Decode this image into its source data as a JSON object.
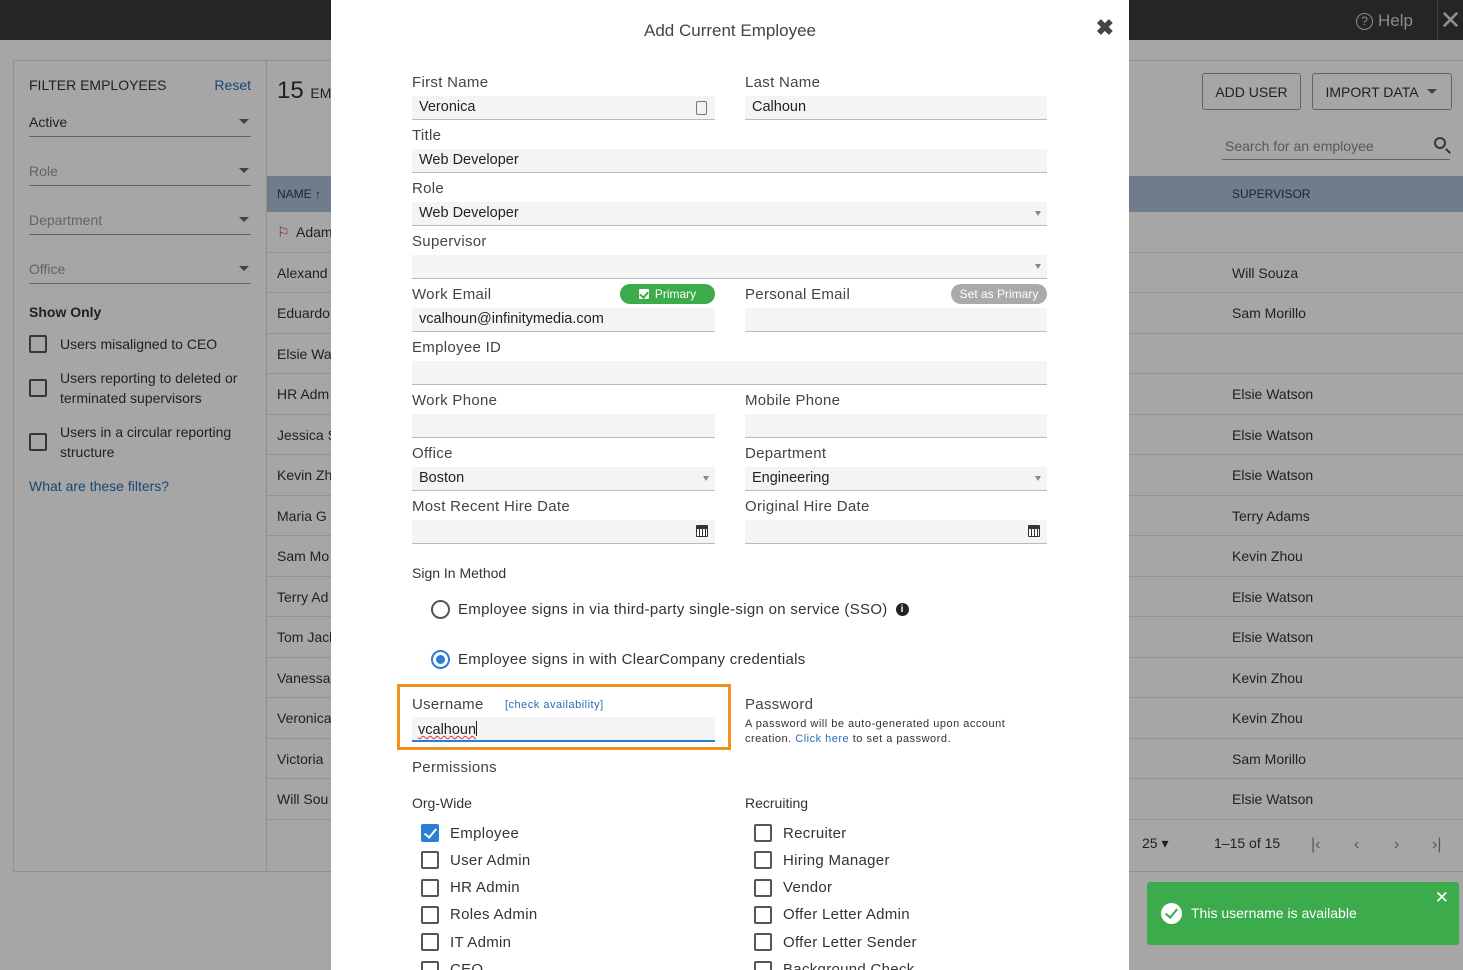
{
  "topbar": {
    "help_label": "Help",
    "help_icon": "question-circle-icon",
    "close_icon": "close-icon"
  },
  "sidebar": {
    "title": "FILTER EMPLOYEES",
    "reset_label": "Reset",
    "status_value": "Active",
    "role_placeholder": "Role",
    "department_placeholder": "Department",
    "office_placeholder": "Office",
    "show_only_title": "Show Only",
    "checks": [
      "Users misaligned to CEO",
      "Users reporting to deleted or terminated supervisors",
      "Users in a circular reporting structure"
    ],
    "help_link": "What are these filters?"
  },
  "main": {
    "count": "15",
    "count_suffix": "EM",
    "add_user_label": "ADD USER",
    "import_label": "IMPORT DATA",
    "search_placeholder": "Search for an employee",
    "col_name": "NAME",
    "col_supervisor": "SUPERVISOR",
    "rows": [
      {
        "name": "Adam",
        "supervisor": ""
      },
      {
        "name": "Alexand",
        "supervisor": "Will Souza"
      },
      {
        "name": "Eduardo",
        "supervisor": "Sam Morillo"
      },
      {
        "name": "Elsie Wa",
        "supervisor": ""
      },
      {
        "name": "HR Adm",
        "supervisor": "Elsie Watson"
      },
      {
        "name": "Jessica S",
        "supervisor": "Elsie Watson"
      },
      {
        "name": "Kevin Zh",
        "supervisor": "Elsie Watson"
      },
      {
        "name": "Maria G",
        "supervisor": "Terry Adams"
      },
      {
        "name": "Sam Mo",
        "supervisor": "Kevin Zhou"
      },
      {
        "name": "Terry Ad",
        "supervisor": "Elsie Watson"
      },
      {
        "name": "Tom Jack",
        "supervisor": "Elsie Watson"
      },
      {
        "name": "Vanessa",
        "supervisor": "Kevin Zhou"
      },
      {
        "name": "Veronica",
        "supervisor": "Kevin Zhou"
      },
      {
        "name": "Victoria",
        "supervisor": "Sam Morillo"
      },
      {
        "name": "Will Sou",
        "supervisor": "Elsie Watson"
      }
    ],
    "page_size": "25",
    "range": "1–15 of 15"
  },
  "modal": {
    "title": "Add Current Employee",
    "first_name_label": "First Name",
    "first_name_value": "Veronica",
    "last_name_label": "Last Name",
    "last_name_value": "Calhoun",
    "title_label": "Title",
    "title_value": "Web Developer",
    "role_label": "Role",
    "role_value": "Web Developer",
    "supervisor_label": "Supervisor",
    "supervisor_value": "",
    "work_email_label": "Work Email",
    "primary_badge": "Primary",
    "work_email_value": "vcalhoun@infinitymedia.com",
    "personal_email_label": "Personal Email",
    "set_primary_label": "Set as Primary",
    "personal_email_value": "",
    "employee_id_label": "Employee ID",
    "work_phone_label": "Work Phone",
    "mobile_phone_label": "Mobile Phone",
    "office_label": "Office",
    "office_value": "Boston",
    "department_label": "Department",
    "department_value": "Engineering",
    "hire_date_label": "Most Recent Hire Date",
    "original_hire_label": "Original Hire Date",
    "sign_in_title": "Sign In Method",
    "sso_option": "Employee signs in via third-party single-sign on service (SSO)",
    "credentials_option": "Employee signs in with ClearCompany credentials",
    "selected_sign_in": "credentials",
    "username_label": "Username",
    "check_availability": "[check availability]",
    "username_value": "vcalhoun",
    "password_label": "Password",
    "password_note": "A password will be auto-generated upon account creation.",
    "password_link": "Click here",
    "password_note_end": "to set a password.",
    "permissions_title": "Permissions",
    "org_wide_title": "Org-Wide",
    "recruiting_title": "Recruiting",
    "org_wide": [
      {
        "label": "Employee",
        "checked": true
      },
      {
        "label": "User Admin",
        "checked": false
      },
      {
        "label": "HR Admin",
        "checked": false
      },
      {
        "label": "Roles Admin",
        "checked": false
      },
      {
        "label": "IT Admin",
        "checked": false
      },
      {
        "label": "CEO",
        "checked": false
      }
    ],
    "recruiting": [
      {
        "label": "Recruiter",
        "checked": false
      },
      {
        "label": "Hiring Manager",
        "checked": false
      },
      {
        "label": "Vendor",
        "checked": false
      },
      {
        "label": "Offer Letter Admin",
        "checked": false
      },
      {
        "label": "Offer Letter Sender",
        "checked": false
      },
      {
        "label": "Background Check",
        "checked": false
      }
    ]
  },
  "toast": {
    "message": "This username is available",
    "color": "#3bab4b"
  },
  "colors": {
    "accent": "#2a7fd4",
    "highlight": "#f0901e",
    "success": "#3bab4b",
    "header_row": "#a9bfd6"
  }
}
